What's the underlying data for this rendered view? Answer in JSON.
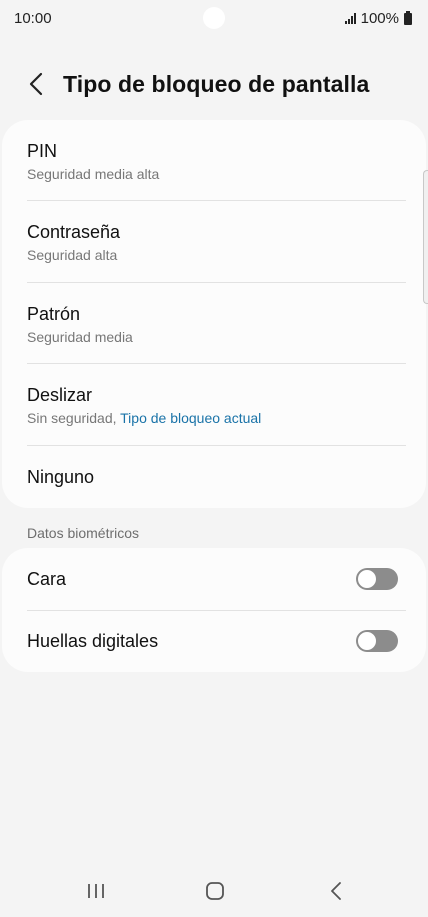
{
  "status_bar": {
    "time": "10:00",
    "battery": "100%"
  },
  "header": {
    "title": "Tipo de bloqueo de pantalla",
    "back_icon": "chevron-left-icon"
  },
  "lock_options": [
    {
      "title": "PIN",
      "subtitle": "Seguridad media alta"
    },
    {
      "title": "Contraseña",
      "subtitle": "Seguridad alta"
    },
    {
      "title": "Patrón",
      "subtitle": "Seguridad media"
    },
    {
      "title": "Deslizar",
      "subtitle": "Sin seguridad, ",
      "subtitle_accent": "Tipo de bloqueo actual"
    },
    {
      "title": "Ninguno"
    }
  ],
  "biometrics": {
    "section_label": "Datos biométricos",
    "items": [
      {
        "title": "Cara",
        "enabled": false
      },
      {
        "title": "Huellas digitales",
        "enabled": false
      }
    ]
  },
  "colors": {
    "background": "#f4f4f4",
    "card": "#fcfcfc",
    "accent": "#1a73a8",
    "toggle_off": "#8c8c8c"
  },
  "nav_bar": {
    "icons": [
      "recents-icon",
      "home-icon",
      "back-icon"
    ]
  }
}
